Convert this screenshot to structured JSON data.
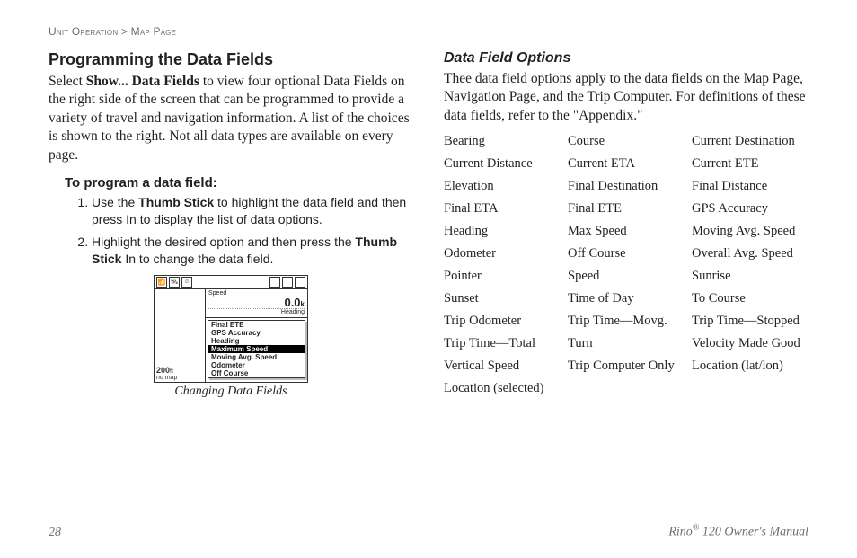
{
  "breadcrumb": {
    "section": "Unit Operation",
    "sep": ">",
    "page": "Map Page"
  },
  "left": {
    "heading": "Programming the Data Fields",
    "intro_pre": "Select ",
    "intro_bold": "Show... Data Fields",
    "intro_post": " to view four optional Data Fields on the right side of the screen that can be programmed to provide a variety of travel and navigation information. A list of the choices is shown to the right. Not all data types are available on every page.",
    "sub": "To program a data field:",
    "step1_pre": "Use the ",
    "step1_bold": "Thumb Stick",
    "step1_post": " to highlight the data field and then press In to display the list of data options.",
    "step2_pre": "Highlight the desired option and then press the ",
    "step2_bold": "Thumb Stick",
    "step2_post": " In to change the data field.",
    "caption": "Changing Data Fields"
  },
  "device": {
    "speed_label": "Speed",
    "speed_value": "0.0",
    "speed_unit_row": "Heading",
    "scale_value": "200",
    "scale_unit": "ft",
    "nomap": "no map",
    "menu": [
      "Final ETE",
      "GPS Accuracy",
      "Heading",
      "Maximum Speed",
      "Moving Avg. Speed",
      "Odometer",
      "Off Course"
    ],
    "menu_selected_index": 3,
    "k_unit": "k"
  },
  "right": {
    "heading": "Data Field Options",
    "intro": "Thee data field options apply to the data fields on the Map Page, Navigation Page, and the Trip Computer. For definitions of these data fields, refer to the \"Appendix.\"",
    "options": [
      "Bearing",
      "Course",
      "Current Destination",
      "Current Distance",
      "Current ETA",
      "Current ETE",
      "Elevation",
      "Final Destination",
      "Final Distance",
      "Final ETA",
      "Final ETE",
      "GPS Accuracy",
      "Heading",
      "Max Speed",
      "Moving Avg. Speed",
      "Odometer",
      "Off Course",
      "Overall Avg. Speed",
      "Pointer",
      "Speed",
      "Sunrise",
      "Sunset",
      "Time of Day",
      "To Course",
      "Trip Odometer",
      "Trip Time—Movg.",
      "Trip Time—Stopped",
      "Trip Time—Total",
      "Turn",
      "Velocity Made Good",
      "Vertical Speed",
      "Trip Computer Only",
      "Location (lat/lon)",
      "Location (selected)",
      "",
      ""
    ]
  },
  "footer": {
    "page_number": "28",
    "product_pre": "Rino",
    "product_post": " 120 Owner's Manual",
    "reg": "®"
  }
}
